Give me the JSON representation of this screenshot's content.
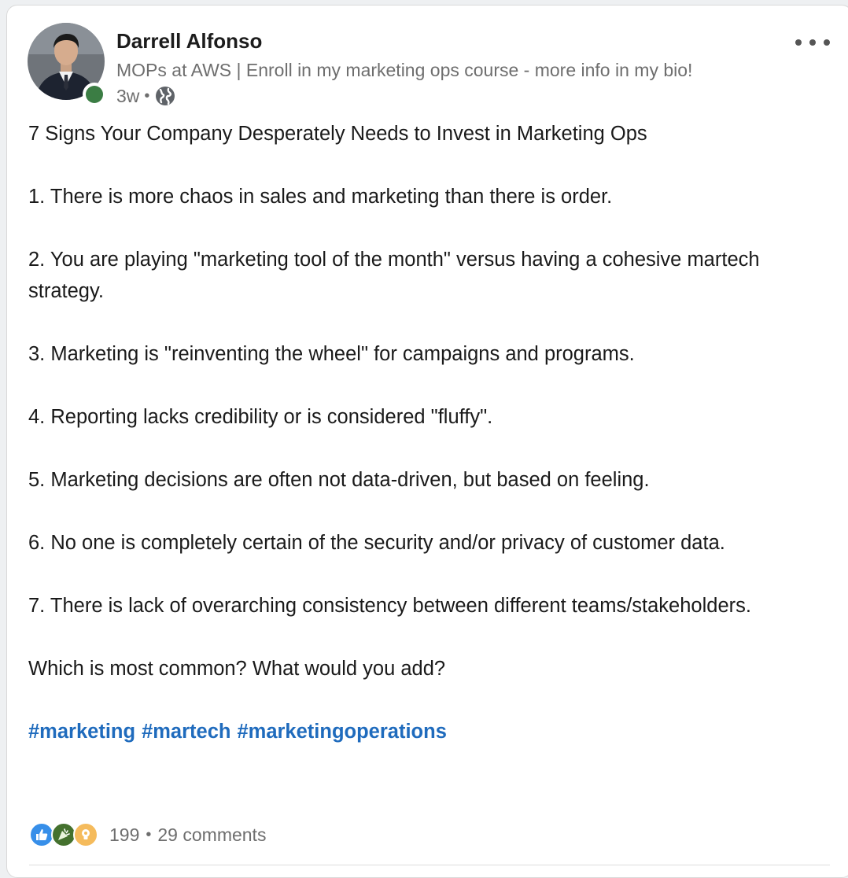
{
  "author": {
    "name": "Darrell Alfonso",
    "headline": "MOPs at AWS | Enroll in my marketing ops course - more info in my bio!",
    "time_ago": "3w",
    "separator": "•"
  },
  "post": {
    "title": "7 Signs Your Company Desperately Needs to Invest in Marketing Ops",
    "points": [
      "1. There is more chaos in sales and marketing than there is order.",
      "2. You are playing \"marketing tool of the month\" versus having a cohesive martech strategy.",
      "3. Marketing is \"reinventing the wheel\" for campaigns and programs.",
      "4. Reporting lacks credibility or is considered \"fluffy\".",
      "5. Marketing decisions are often not data-driven, but based on feeling.",
      "6. No one is completely certain of the security and/or privacy of customer data.",
      "7. There is lack of overarching consistency between different teams/stakeholders."
    ],
    "question": "Which is most common? What would you add?",
    "hashtags": [
      "#marketing",
      "#martech",
      "#marketingoperations"
    ]
  },
  "social": {
    "reaction_icons": [
      "like-icon",
      "celebrate-icon",
      "insightful-icon"
    ],
    "reactions_count": "199",
    "separator": "•",
    "comments": "29 comments"
  },
  "colors": {
    "hashtag": "#1f6bbd",
    "presence": "#3b7d44",
    "muted_text": "#6e6e6e"
  }
}
